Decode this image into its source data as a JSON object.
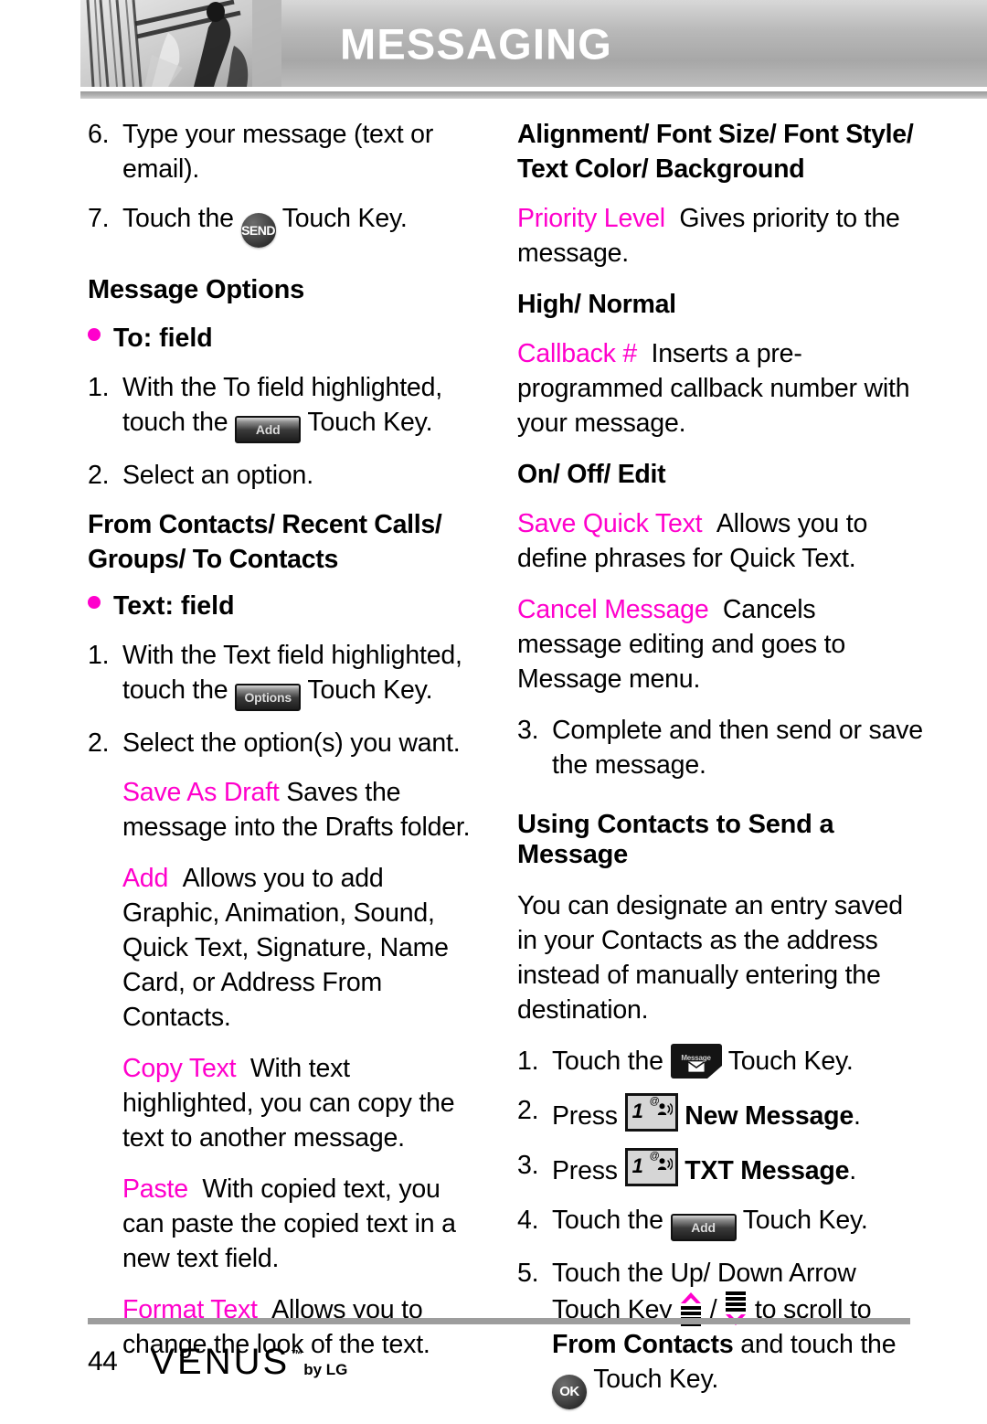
{
  "header": {
    "title": "MESSAGING",
    "photo_alt": "curtains-photo"
  },
  "colors": {
    "accent": "#ff00cc",
    "header_bg": "#b9b9b9",
    "rule": "#9d9d9d"
  },
  "left_column": {
    "step6": {
      "num": "6.",
      "text": "Type your message (text or email)."
    },
    "step7": {
      "num": "7.",
      "before": "Touch the",
      "key": "SEND",
      "after": "Touch Key."
    },
    "section_title": "Message Options",
    "to_field": "To: field",
    "to_step1": {
      "num": "1.",
      "before": "With the To field highlighted, touch the",
      "key": "Add",
      "after": "Touch Key."
    },
    "to_step2": {
      "num": "2.",
      "text": "Select an option."
    },
    "to_options": "From Contacts/ Recent Calls/ Groups/ To Contacts",
    "text_field": "Text: field",
    "text_step1": {
      "num": "1.",
      "before": "With the Text field highlighted, touch the",
      "key": "Options",
      "after": "Touch Key."
    },
    "text_step2": {
      "num": "2.",
      "text": "Select the option(s) you want."
    },
    "options": [
      {
        "term": "Save As Draft",
        "desc": "Saves the message into the Drafts folder."
      },
      {
        "term": "Add",
        "desc": "Allows you to add Graphic, Animation, Sound, Quick Text, Signature, Name Card, or Address From Contacts."
      },
      {
        "term": "Copy Text",
        "desc": "With text highlighted, you can copy the text to another message."
      },
      {
        "term": "Paste",
        "desc": "With copied text, you can paste the copied text in a new text field."
      },
      {
        "term": "Format Text",
        "desc": "Allows you to change the look of the text."
      }
    ]
  },
  "right_column": {
    "format_values": "Alignment/ Font Size/ Font Style/ Text Color/ Background",
    "options": [
      {
        "term": "Priority Level",
        "desc": "Gives priority to the message.",
        "values": "High/ Normal"
      },
      {
        "term": "Callback #",
        "desc": "Inserts a pre-programmed callback number with your message.",
        "values": "On/ Off/ Edit"
      },
      {
        "term": "Save Quick Text",
        "desc": "Allows you to define phrases for Quick Text.",
        "values": ""
      },
      {
        "term": "Cancel Message",
        "desc": "Cancels message editing and goes to Message menu.",
        "values": ""
      }
    ],
    "step3": {
      "num": "3.",
      "text": "Complete and then send or save the message."
    },
    "section_title": "Using Contacts to Send a Message",
    "intro": "You can designate an entry saved in your Contacts as the address instead of manually entering the destination.",
    "steps": [
      {
        "num": "1.",
        "before": "Touch the",
        "key": "Message",
        "after": "Touch Key."
      },
      {
        "num": "2.",
        "before": "Press",
        "key": "1",
        "after": "New Message",
        "after_tail": "."
      },
      {
        "num": "3.",
        "before": "Press",
        "key": "1",
        "after": "TXT Message",
        "after_tail": "."
      },
      {
        "num": "4.",
        "before": "Touch the",
        "key": "Add",
        "after": "Touch Key."
      }
    ],
    "step5": {
      "num": "5.",
      "part1": "Touch the Up/ Down Arrow Touch Key",
      "separator": "/",
      "part2": "to scroll to",
      "bold_target": "From Contacts",
      "part3": "and touch the",
      "part4": "Touch Key."
    }
  },
  "footer": {
    "page_number": "44",
    "brand": "VENUS",
    "trademark": "™",
    "by": "by LG"
  }
}
